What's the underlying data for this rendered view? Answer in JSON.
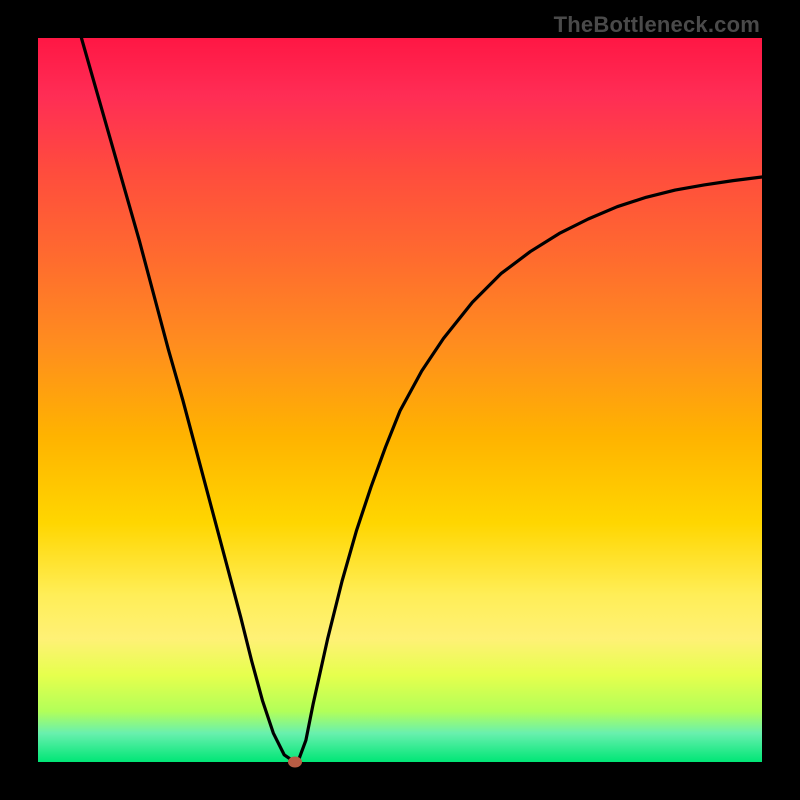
{
  "watermark": "TheBottleneck.com",
  "colors": {
    "frame": "#000000",
    "curve": "#000000",
    "marker": "#b85c44"
  },
  "chart_data": {
    "type": "line",
    "title": "",
    "xlabel": "",
    "ylabel": "",
    "xlim": [
      0,
      100
    ],
    "ylim": [
      0,
      100
    ],
    "series": [
      {
        "name": "bottleneck-curve",
        "x": [
          6,
          8,
          10,
          12,
          14,
          16,
          18,
          20,
          22,
          24,
          26,
          28,
          29.5,
          31,
          32.5,
          34,
          35,
          36,
          37,
          38,
          40,
          42,
          44,
          46,
          48,
          50,
          53,
          56,
          60,
          64,
          68,
          72,
          76,
          80,
          84,
          88,
          92,
          96,
          100
        ],
        "y": [
          100,
          93,
          86,
          79,
          72,
          64.5,
          57,
          50,
          42.5,
          35,
          27.5,
          20,
          14,
          8.5,
          4,
          1,
          0.3,
          0.3,
          3,
          8,
          17,
          25,
          32,
          38,
          43.5,
          48.5,
          54,
          58.5,
          63.5,
          67.5,
          70.5,
          73,
          75,
          76.7,
          78,
          79,
          79.7,
          80.3,
          80.8
        ]
      }
    ],
    "marker": {
      "x": 35.5,
      "y": 0,
      "color": "#b85c44"
    }
  }
}
